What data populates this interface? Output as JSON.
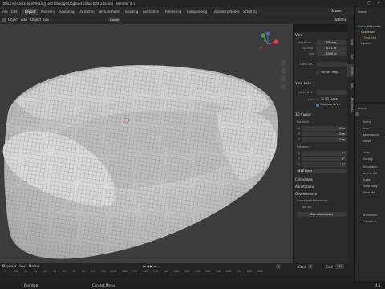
{
  "window": {
    "title": "tteeDrive\\Desktop\\WIP\\Dog Bed Package\\Dog bed 2\\dog bed 2.blend] - Blender 4.1"
  },
  "menu": {
    "items": [
      "File",
      "Edit",
      "Render",
      "Window",
      "Help"
    ]
  },
  "workspaces": [
    "Layout",
    "Modeling",
    "Sculpting",
    "UV Editing",
    "Texture Paint",
    "Shading",
    "Animation",
    "Rendering",
    "Compositing",
    "Geometry Nodes",
    "Scripting"
  ],
  "scene_label": "Scene",
  "header2": {
    "left": [
      "Object",
      "Add",
      "Object",
      "GIS"
    ],
    "mode": "Global",
    "options": "Options"
  },
  "npanel": {
    "view_title": "View",
    "focal_label": "Focal Len...",
    "focal_value": "50 mm",
    "clip_start_label": "Clip Start",
    "clip_start_value": "0.01 m",
    "end_label": "End",
    "end_value": "1000 m",
    "local_camera_label": "Local Ca...",
    "render_region_label": "Render Regi...",
    "view_lock_title": "View Lock",
    "lock_to_obj_label": "Lock to O...",
    "lock_label": "Lock",
    "lock_3d_cursor": "To 3D Cursor",
    "lock_camera": "Camera to V...",
    "cursor_title": "3D Cursor",
    "location_label": "Location",
    "x_label": "X",
    "x_value": "0 m",
    "y_label": "Y",
    "y_value": "0 m",
    "z_label": "Z",
    "z_value": "0 m",
    "rotation_label": "Rotation",
    "rx_value": "0°",
    "ry_value": "0°",
    "rz_value": "0°",
    "euler": "XYZ Euler",
    "collections": "Collections",
    "annotations": "Annotations",
    "georef_title": "Georeference",
    "georef_sub": "Scene georeferencing :",
    "not_set": "Not set",
    "geo_coords": "Geo coordinates"
  },
  "side_tabs": [
    "Item",
    "Tool",
    "View",
    "Edit",
    "BlenderKit"
  ],
  "outliner": {
    "header": "Scene",
    "rows": [
      "Scene Collection",
      "Collection",
      "Dog.Bed",
      "Hydra..."
    ]
  },
  "properties": {
    "header": "Scene",
    "sections": [
      "Scene",
      "Cam",
      "Background",
      "Active",
      "Units",
      "Gravity",
      "Simulation",
      "Keying Set",
      "Audio",
      "Rigid Body",
      "Mask Ma...",
      "Animation",
      "Custom P..."
    ]
  },
  "timeline": {
    "menus": [
      "Playback",
      "Keying",
      "View",
      "Marker"
    ],
    "ticks": [
      "0",
      "10",
      "20",
      "30",
      "40",
      "50",
      "60",
      "70",
      "80",
      "90",
      "100",
      "110",
      "120",
      "130",
      "140",
      "150",
      "160",
      "170",
      "180",
      "190",
      "200",
      "210",
      "220",
      "230",
      "240",
      "250"
    ],
    "start_label": "Start",
    "start_value": "1",
    "end_label": "End",
    "end_value": "250",
    "current": "1"
  },
  "status": {
    "pan": "Pan View",
    "context": "Context Menu",
    "version": "4.1"
  },
  "colors": {
    "viewport": "#3d3d3d",
    "accent": "#4772b3",
    "mesh": "#d4d4d4"
  }
}
